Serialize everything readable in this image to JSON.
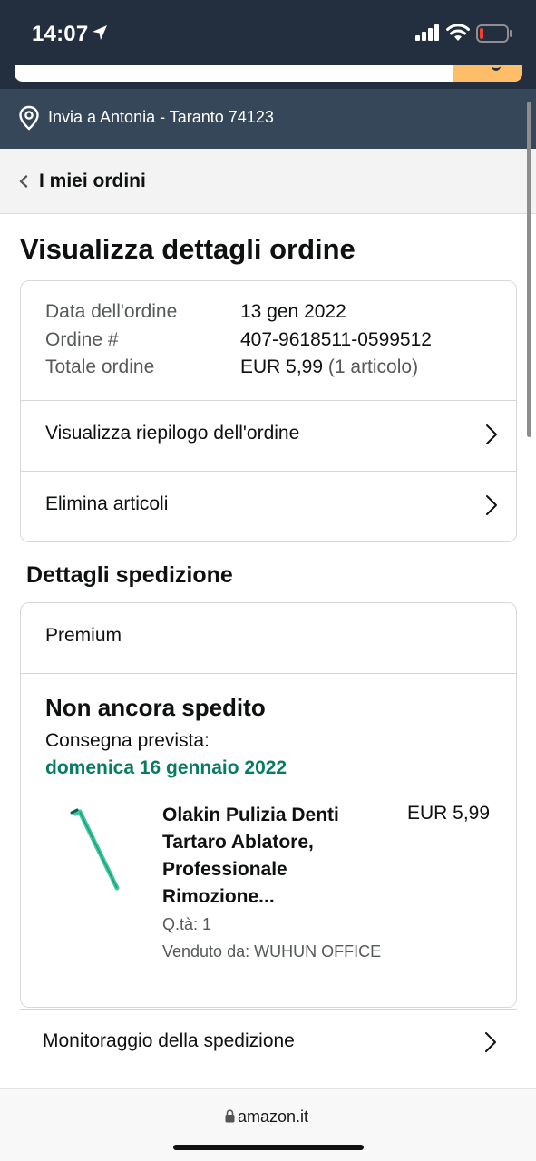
{
  "status_bar": {
    "time": "14:07",
    "icons": [
      "location-arrow-icon",
      "cellular-signal-icon",
      "wifi-icon",
      "battery-low-icon"
    ],
    "battery_color": "#ff3b30"
  },
  "header": {
    "deliver_to": "Invia a Antonia - Taranto 74123",
    "deliver_icon": "location-pin-icon",
    "search_button_color": "#febd69",
    "header_bg": "#232f3e",
    "deliver_bg": "#37475a"
  },
  "breadcrumb": {
    "back_label": "I miei ordini"
  },
  "page": {
    "title": "Visualizza dettagli ordine"
  },
  "order_summary": {
    "rows": [
      {
        "label": "Data dell'ordine",
        "value": "13 gen 2022"
      },
      {
        "label": "Ordine #",
        "value": "407-9618511-0599512"
      },
      {
        "label": "Totale ordine",
        "value": "EUR 5,99",
        "sub": " (1 articolo)"
      }
    ],
    "links": [
      {
        "label": "Visualizza riepilogo dell'ordine"
      },
      {
        "label": "Elimina articoli"
      }
    ]
  },
  "shipment": {
    "section_title": "Dettagli spedizione",
    "type": "Premium",
    "status": "Non ancora spedito",
    "delivery_label": "Consegna prevista:",
    "delivery_date": "domenica 16 gennaio 2022",
    "delivery_date_color": "#067d62",
    "item": {
      "title": "Olakin Pulizia Denti Tartaro Ablatore, Professionale Rimozione...",
      "price": "EUR 5,99",
      "qty": "Q.tà: 1",
      "seller": "Venduto da: WUHUN OFFICE"
    },
    "track_label": "Monitoraggio della spedizione"
  },
  "browser": {
    "url": "amazon.it"
  }
}
